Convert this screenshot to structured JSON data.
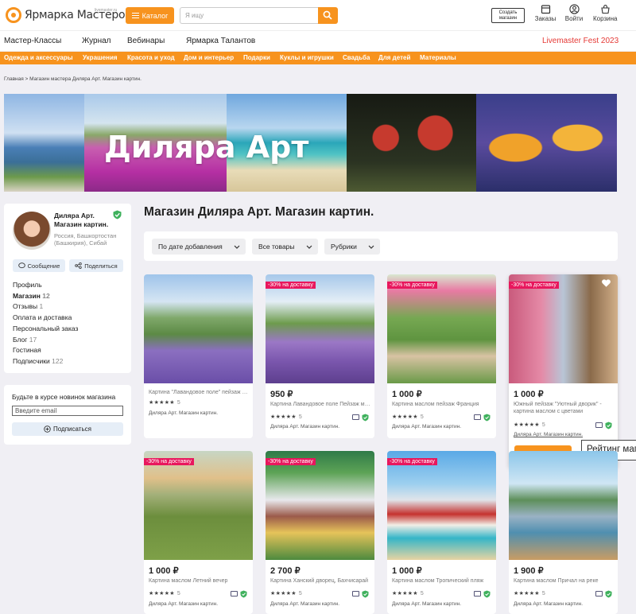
{
  "header": {
    "logo_text": "Ярмарка Мастеров",
    "logo_sub": "livemaster.ru",
    "catalog_label": "Каталог",
    "search_placeholder": "Я ищу",
    "create_shop": "Создать магазин",
    "orders": "Заказы",
    "login": "Войти",
    "cart": "Корзина"
  },
  "nav": {
    "items": [
      "Мастер-Классы",
      "Журнал",
      "Вебинары",
      "Ярмарка Талантов"
    ],
    "fest": "Livemaster Fest 2023"
  },
  "categories": [
    "Одежда и аксессуары",
    "Украшения",
    "Красота и уход",
    "Дом и интерьер",
    "Подарки",
    "Куклы и игрушки",
    "Свадьба",
    "Для детей",
    "Материалы"
  ],
  "breadcrumbs": "Главная > Магазин мастера Диляра Арт. Магазин картин.",
  "banner_title": "Диляра Арт",
  "shop": {
    "name": "Диляра Арт. Магазин картин.",
    "location": "Россия, Башкортостан (Башкирия), Сибай",
    "message_btn": "Сообщение",
    "share_btn": "Поделиться",
    "menu": [
      {
        "label": "Профиль",
        "count": ""
      },
      {
        "label": "Магазин",
        "count": "12"
      },
      {
        "label": "Отзывы",
        "count": "1"
      },
      {
        "label": "Оплата и доставка",
        "count": ""
      },
      {
        "label": "Персональный заказ",
        "count": ""
      },
      {
        "label": "Блог",
        "count": "17"
      },
      {
        "label": "Гостиная",
        "count": ""
      },
      {
        "label": "Подписчики",
        "count": "122"
      }
    ]
  },
  "newsletter": {
    "title": "Будьте в курсе новинок магазина",
    "email_placeholder": "Введите email",
    "subscribe": "Подписаться"
  },
  "page_title": "Магазин Диляра Арт. Магазин картин.",
  "filters": [
    "По дате добавления",
    "Все товары",
    "Рубрики"
  ],
  "products": [
    {
      "price": "",
      "title": "Картина \"Лавандовое поле\" пейзаж маслом",
      "rating": "5",
      "shop": "Диляра Арт. Магазин картин.",
      "badge": ""
    },
    {
      "price": "950 ₽",
      "title": "Картина Лавандовое поле Пейзаж маслом",
      "rating": "5",
      "shop": "Диляра Арт. Магазин картин.",
      "badge": "-30% на доставку"
    },
    {
      "price": "1 000 ₽",
      "title": "Картина маслом пейзаж Франция",
      "rating": "5",
      "shop": "Диляра Арт. Магазин картин.",
      "badge": "-30% на доставку"
    },
    {
      "price": "1 000 ₽",
      "title": "Южный пейзаж \"Уютный дворик\" - картина маслом с цветами",
      "rating": "5",
      "shop": "Диляра Арт. Магазин картин.",
      "badge": "-30% на доставку"
    },
    {
      "price": "1 000 ₽",
      "title": "Картина маслом Летний вечер",
      "rating": "5",
      "shop": "Диляра Арт. Магазин картин.",
      "badge": "-30% на доставку"
    },
    {
      "price": "2 700 ₽",
      "title": "Картина Ханский дворец, Бахчисарай",
      "rating": "5",
      "shop": "Диляра Арт. Магазин картин.",
      "badge": "-30% на доставку"
    },
    {
      "price": "1 000 ₽",
      "title": "Картина маслом Тропический пляж",
      "rating": "5",
      "shop": "Диляра Арт. Магазин картин.",
      "badge": "-30% на доставку"
    },
    {
      "price": "1 900 ₽",
      "title": "Картина маслом Причал на реке",
      "rating": "5",
      "shop": "Диляра Арт. Магазин картин.",
      "badge": ""
    }
  ],
  "cart_button": "В корзину",
  "tooltip": "Рейтинг магазина",
  "colors": {
    "accent": "#f7931e",
    "badge": "#e8175d",
    "fest": "#e53935"
  }
}
